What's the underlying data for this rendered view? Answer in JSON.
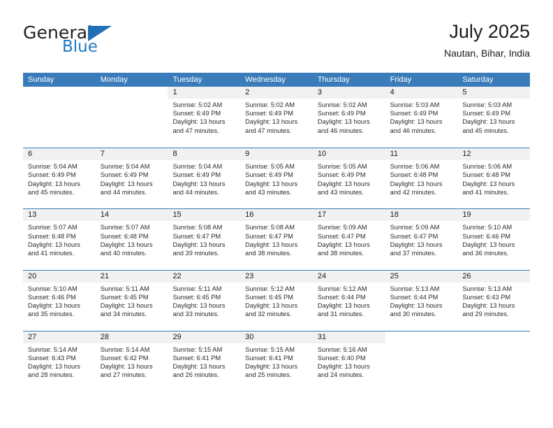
{
  "brand": {
    "name_part1": "General",
    "name_part2": "Blue",
    "accent_color": "#1f7bc1",
    "triangle_icon": "triangle-icon"
  },
  "header": {
    "title": "July 2025",
    "subtitle": "Nautan, Bihar, India"
  },
  "theme": {
    "header_bg": "#3a7cba",
    "day_band_bg": "#f1f1f1",
    "text_color": "#2b2b2b"
  },
  "weekdays": [
    "Sunday",
    "Monday",
    "Tuesday",
    "Wednesday",
    "Thursday",
    "Friday",
    "Saturday"
  ],
  "weeks": [
    [
      {
        "day": "",
        "blank": true,
        "sunrise": "",
        "sunset": "",
        "daylight1": "",
        "daylight2": ""
      },
      {
        "day": "",
        "blank": true,
        "sunrise": "",
        "sunset": "",
        "daylight1": "",
        "daylight2": ""
      },
      {
        "day": "1",
        "sunrise": "Sunrise: 5:02 AM",
        "sunset": "Sunset: 6:49 PM",
        "daylight1": "Daylight: 13 hours",
        "daylight2": "and 47 minutes."
      },
      {
        "day": "2",
        "sunrise": "Sunrise: 5:02 AM",
        "sunset": "Sunset: 6:49 PM",
        "daylight1": "Daylight: 13 hours",
        "daylight2": "and 47 minutes."
      },
      {
        "day": "3",
        "sunrise": "Sunrise: 5:02 AM",
        "sunset": "Sunset: 6:49 PM",
        "daylight1": "Daylight: 13 hours",
        "daylight2": "and 46 minutes."
      },
      {
        "day": "4",
        "sunrise": "Sunrise: 5:03 AM",
        "sunset": "Sunset: 6:49 PM",
        "daylight1": "Daylight: 13 hours",
        "daylight2": "and 46 minutes."
      },
      {
        "day": "5",
        "sunrise": "Sunrise: 5:03 AM",
        "sunset": "Sunset: 6:49 PM",
        "daylight1": "Daylight: 13 hours",
        "daylight2": "and 45 minutes."
      }
    ],
    [
      {
        "day": "6",
        "sunrise": "Sunrise: 5:04 AM",
        "sunset": "Sunset: 6:49 PM",
        "daylight1": "Daylight: 13 hours",
        "daylight2": "and 45 minutes."
      },
      {
        "day": "7",
        "sunrise": "Sunrise: 5:04 AM",
        "sunset": "Sunset: 6:49 PM",
        "daylight1": "Daylight: 13 hours",
        "daylight2": "and 44 minutes."
      },
      {
        "day": "8",
        "sunrise": "Sunrise: 5:04 AM",
        "sunset": "Sunset: 6:49 PM",
        "daylight1": "Daylight: 13 hours",
        "daylight2": "and 44 minutes."
      },
      {
        "day": "9",
        "sunrise": "Sunrise: 5:05 AM",
        "sunset": "Sunset: 6:49 PM",
        "daylight1": "Daylight: 13 hours",
        "daylight2": "and 43 minutes."
      },
      {
        "day": "10",
        "sunrise": "Sunrise: 5:05 AM",
        "sunset": "Sunset: 6:49 PM",
        "daylight1": "Daylight: 13 hours",
        "daylight2": "and 43 minutes."
      },
      {
        "day": "11",
        "sunrise": "Sunrise: 5:06 AM",
        "sunset": "Sunset: 6:48 PM",
        "daylight1": "Daylight: 13 hours",
        "daylight2": "and 42 minutes."
      },
      {
        "day": "12",
        "sunrise": "Sunrise: 5:06 AM",
        "sunset": "Sunset: 6:48 PM",
        "daylight1": "Daylight: 13 hours",
        "daylight2": "and 41 minutes."
      }
    ],
    [
      {
        "day": "13",
        "sunrise": "Sunrise: 5:07 AM",
        "sunset": "Sunset: 6:48 PM",
        "daylight1": "Daylight: 13 hours",
        "daylight2": "and 41 minutes."
      },
      {
        "day": "14",
        "sunrise": "Sunrise: 5:07 AM",
        "sunset": "Sunset: 6:48 PM",
        "daylight1": "Daylight: 13 hours",
        "daylight2": "and 40 minutes."
      },
      {
        "day": "15",
        "sunrise": "Sunrise: 5:08 AM",
        "sunset": "Sunset: 6:47 PM",
        "daylight1": "Daylight: 13 hours",
        "daylight2": "and 39 minutes."
      },
      {
        "day": "16",
        "sunrise": "Sunrise: 5:08 AM",
        "sunset": "Sunset: 6:47 PM",
        "daylight1": "Daylight: 13 hours",
        "daylight2": "and 38 minutes."
      },
      {
        "day": "17",
        "sunrise": "Sunrise: 5:09 AM",
        "sunset": "Sunset: 6:47 PM",
        "daylight1": "Daylight: 13 hours",
        "daylight2": "and 38 minutes."
      },
      {
        "day": "18",
        "sunrise": "Sunrise: 5:09 AM",
        "sunset": "Sunset: 6:47 PM",
        "daylight1": "Daylight: 13 hours",
        "daylight2": "and 37 minutes."
      },
      {
        "day": "19",
        "sunrise": "Sunrise: 5:10 AM",
        "sunset": "Sunset: 6:46 PM",
        "daylight1": "Daylight: 13 hours",
        "daylight2": "and 36 minutes."
      }
    ],
    [
      {
        "day": "20",
        "sunrise": "Sunrise: 5:10 AM",
        "sunset": "Sunset: 6:46 PM",
        "daylight1": "Daylight: 13 hours",
        "daylight2": "and 35 minutes."
      },
      {
        "day": "21",
        "sunrise": "Sunrise: 5:11 AM",
        "sunset": "Sunset: 6:45 PM",
        "daylight1": "Daylight: 13 hours",
        "daylight2": "and 34 minutes."
      },
      {
        "day": "22",
        "sunrise": "Sunrise: 5:11 AM",
        "sunset": "Sunset: 6:45 PM",
        "daylight1": "Daylight: 13 hours",
        "daylight2": "and 33 minutes."
      },
      {
        "day": "23",
        "sunrise": "Sunrise: 5:12 AM",
        "sunset": "Sunset: 6:45 PM",
        "daylight1": "Daylight: 13 hours",
        "daylight2": "and 32 minutes."
      },
      {
        "day": "24",
        "sunrise": "Sunrise: 5:12 AM",
        "sunset": "Sunset: 6:44 PM",
        "daylight1": "Daylight: 13 hours",
        "daylight2": "and 31 minutes."
      },
      {
        "day": "25",
        "sunrise": "Sunrise: 5:13 AM",
        "sunset": "Sunset: 6:44 PM",
        "daylight1": "Daylight: 13 hours",
        "daylight2": "and 30 minutes."
      },
      {
        "day": "26",
        "sunrise": "Sunrise: 5:13 AM",
        "sunset": "Sunset: 6:43 PM",
        "daylight1": "Daylight: 13 hours",
        "daylight2": "and 29 minutes."
      }
    ],
    [
      {
        "day": "27",
        "sunrise": "Sunrise: 5:14 AM",
        "sunset": "Sunset: 6:43 PM",
        "daylight1": "Daylight: 13 hours",
        "daylight2": "and 28 minutes."
      },
      {
        "day": "28",
        "sunrise": "Sunrise: 5:14 AM",
        "sunset": "Sunset: 6:42 PM",
        "daylight1": "Daylight: 13 hours",
        "daylight2": "and 27 minutes."
      },
      {
        "day": "29",
        "sunrise": "Sunrise: 5:15 AM",
        "sunset": "Sunset: 6:41 PM",
        "daylight1": "Daylight: 13 hours",
        "daylight2": "and 26 minutes."
      },
      {
        "day": "30",
        "sunrise": "Sunrise: 5:15 AM",
        "sunset": "Sunset: 6:41 PM",
        "daylight1": "Daylight: 13 hours",
        "daylight2": "and 25 minutes."
      },
      {
        "day": "31",
        "sunrise": "Sunrise: 5:16 AM",
        "sunset": "Sunset: 6:40 PM",
        "daylight1": "Daylight: 13 hours",
        "daylight2": "and 24 minutes."
      },
      {
        "day": "",
        "blank": true,
        "sunrise": "",
        "sunset": "",
        "daylight1": "",
        "daylight2": ""
      },
      {
        "day": "",
        "blank": true,
        "sunrise": "",
        "sunset": "",
        "daylight1": "",
        "daylight2": ""
      }
    ]
  ]
}
